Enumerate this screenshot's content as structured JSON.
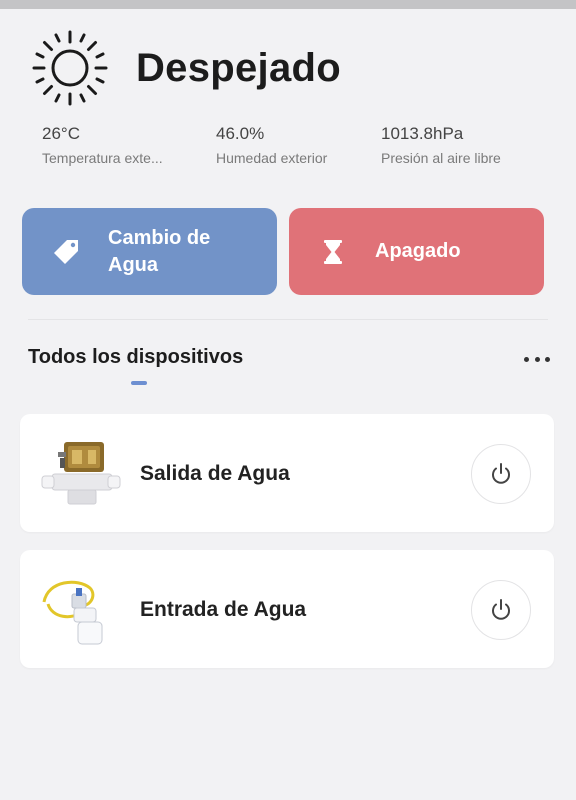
{
  "weather": {
    "condition": "Despejado",
    "icon": "sun-icon",
    "stats": [
      {
        "value": "26°C",
        "label": "Temperatura exte..."
      },
      {
        "value": "46.0%",
        "label": "Humedad exterior"
      },
      {
        "value": "1013.8hPa",
        "label": "Presión al aire libre"
      }
    ]
  },
  "actions": {
    "water_change": {
      "label": "Cambio de Agua",
      "icon": "tag-icon",
      "color": "#7293c8"
    },
    "off": {
      "label": "Apagado",
      "icon": "hourglass-icon",
      "color": "#e07278"
    }
  },
  "devices_section": {
    "title": "Todos los dispositivos",
    "more_icon": "more-dots-icon",
    "accent": "#6d8fd1"
  },
  "devices": [
    {
      "name": "Salida de Agua",
      "image": "solenoid-valve-image",
      "power_icon": "power-icon"
    },
    {
      "name": "Entrada de Agua",
      "image": "water-inlet-fitting-image",
      "power_icon": "power-icon"
    }
  ]
}
